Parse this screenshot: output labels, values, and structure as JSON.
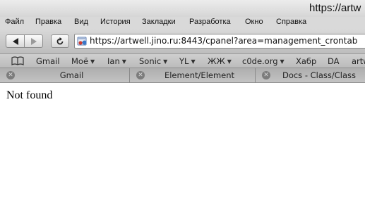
{
  "window": {
    "title": "https://artw"
  },
  "menu": [
    {
      "label": "Файл"
    },
    {
      "label": "Правка"
    },
    {
      "label": "Вид"
    },
    {
      "label": "История"
    },
    {
      "label": "Закладки"
    },
    {
      "label": "Разработка"
    },
    {
      "label": "Окно"
    },
    {
      "label": "Справка"
    }
  ],
  "address": {
    "url": "https://artwell.jino.ru:8443/cpanel?area=management_crontab"
  },
  "bookmarks": [
    {
      "label": "Gmail",
      "dropdown": false
    },
    {
      "label": "Моё",
      "dropdown": true
    },
    {
      "label": "Ian",
      "dropdown": true
    },
    {
      "label": "Sonic",
      "dropdown": true
    },
    {
      "label": "YL",
      "dropdown": true
    },
    {
      "label": "ЖЖ",
      "dropdown": true
    },
    {
      "label": "c0de.org",
      "dropdown": true
    },
    {
      "label": "Хабр",
      "dropdown": false
    },
    {
      "label": "DA",
      "dropdown": false
    },
    {
      "label": "artw",
      "dropdown": false
    }
  ],
  "tabs": [
    {
      "label": "Gmail"
    },
    {
      "label": "Element/Element"
    },
    {
      "label": "Docs - Class/Class"
    }
  ],
  "page": {
    "message": "Not found"
  },
  "colors": {
    "accent": "#3a78c8"
  }
}
